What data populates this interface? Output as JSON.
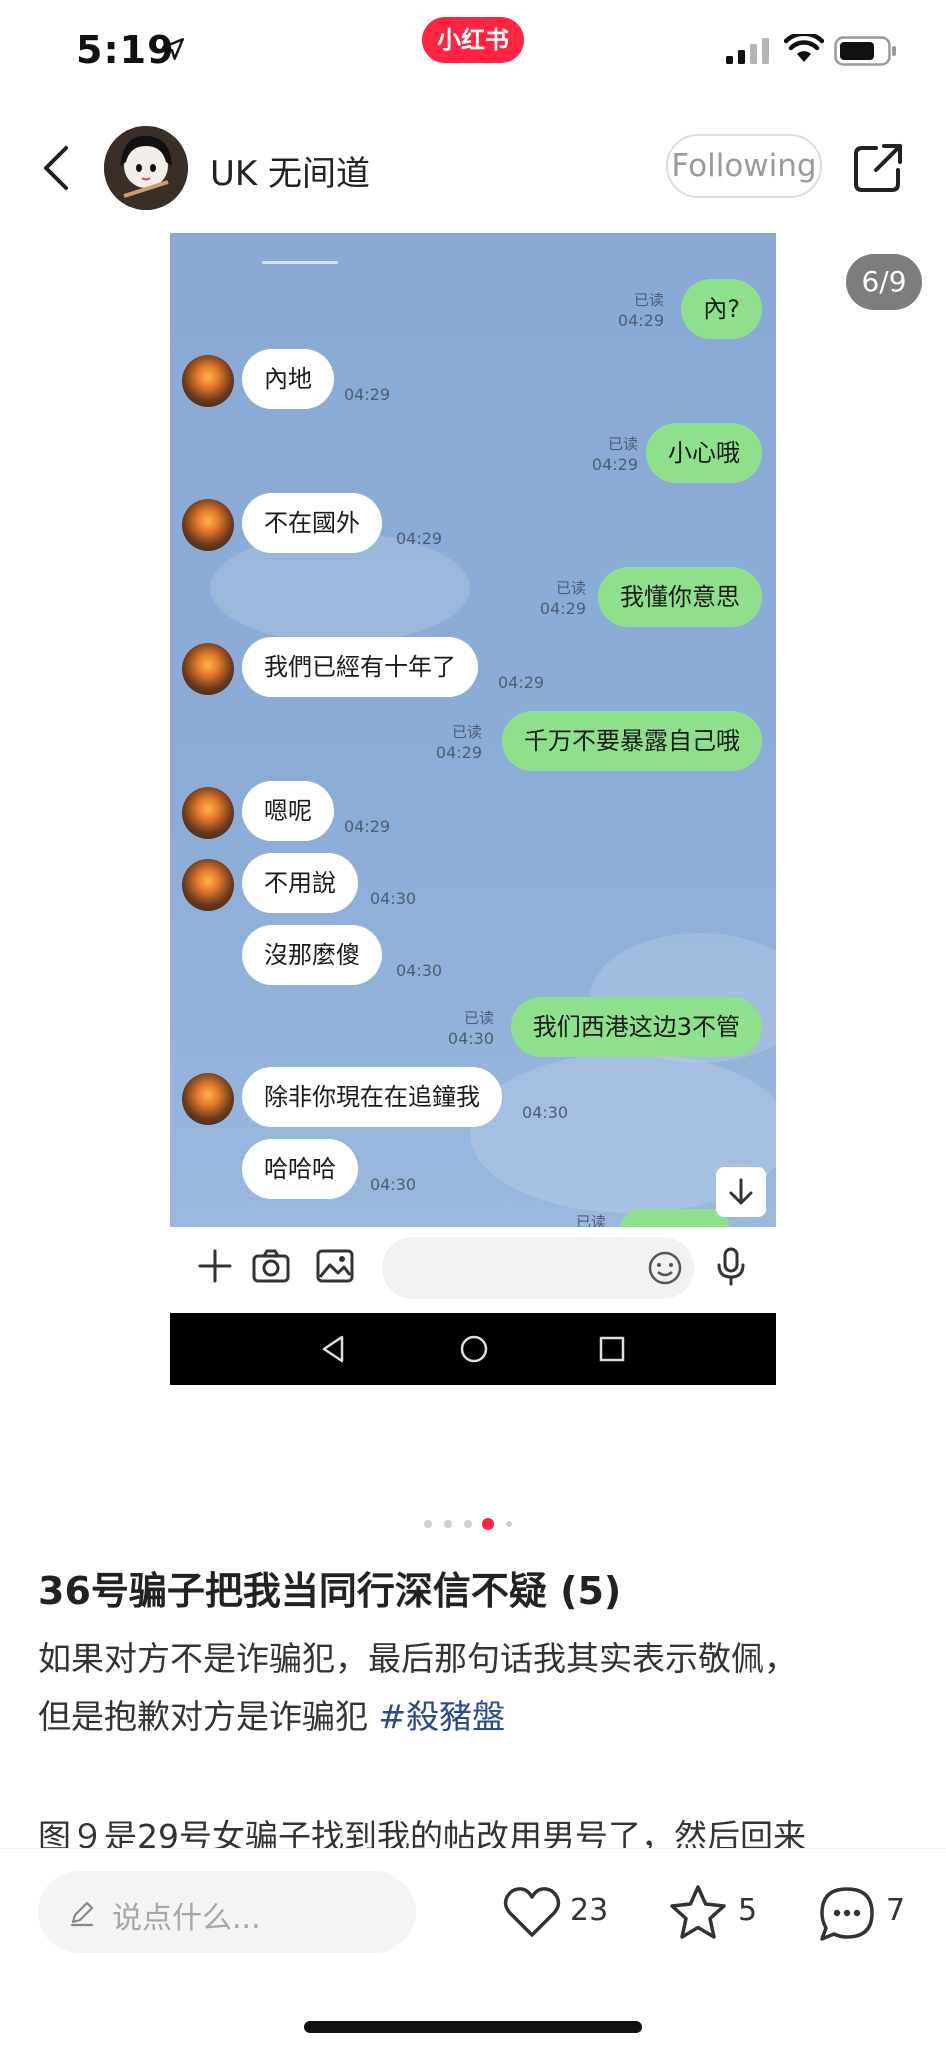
{
  "status_bar": {
    "time": "5:19",
    "app_badge": "小红书"
  },
  "header": {
    "author": "UK 无间道",
    "follow_label": "Following"
  },
  "gallery": {
    "counter": "6/9",
    "active_dot": 3,
    "dot_count": 5
  },
  "chat": {
    "messages": [
      {
        "side": "out",
        "text": "內?",
        "time": "04:29",
        "read": "已读"
      },
      {
        "side": "in",
        "text": "內地",
        "time": "04:29"
      },
      {
        "side": "out",
        "text": "小心哦",
        "time": "04:29",
        "read": "已读"
      },
      {
        "side": "in",
        "text": "不在國外",
        "time": "04:29"
      },
      {
        "side": "out",
        "text": "我懂你意思",
        "time": "04:29",
        "read": "已读"
      },
      {
        "side": "in",
        "text": "我們已經有十年了",
        "time": "04:29"
      },
      {
        "side": "out",
        "text": "千万不要暴露自己哦",
        "time": "04:29",
        "read": "已读"
      },
      {
        "side": "in",
        "text": "嗯呢",
        "time": "04:29"
      },
      {
        "side": "in",
        "text": "不用說",
        "time": "04:30"
      },
      {
        "side": "in",
        "text": "沒那麼傻",
        "time": "04:30"
      },
      {
        "side": "out",
        "text": "我们西港这边3不管",
        "time": "04:30",
        "read": "已读"
      },
      {
        "side": "in",
        "text": "除非你現在在追鐘我",
        "time": "04:30"
      },
      {
        "side": "in",
        "text": "哈哈哈",
        "time": "04:30"
      }
    ],
    "peek_read": "已读"
  },
  "post": {
    "title": "36号骗子把我当同行深信不疑 (5)",
    "body_line1": "如果对方不是诈骗犯，最后那句话我其实表示敬佩，",
    "body_line2": "但是抱歉对方是诈骗犯 ",
    "hashtag": "#殺豬盤",
    "body_next": "图９是29号女骗子找到我的帖改用男号了，然后回来"
  },
  "bottom": {
    "comment_placeholder": "说点什么...",
    "likes": "23",
    "stars": "5",
    "comments": "7"
  },
  "colors": {
    "brand": "#ff2442",
    "chat_bg": "#8aaad5",
    "out_bubble": "#8ee08c",
    "hashtag": "#2a4b8d"
  },
  "icons": [
    "location-arrow-icon",
    "signal-icon",
    "wifi-icon",
    "battery-icon",
    "back-chevron-icon",
    "share-icon",
    "plus-icon",
    "camera-icon",
    "image-icon",
    "emoji-icon",
    "mic-icon",
    "nav-back-icon",
    "nav-home-icon",
    "nav-recents-icon",
    "arrow-down-icon",
    "pencil-icon",
    "heart-icon",
    "star-icon",
    "comment-icon"
  ]
}
